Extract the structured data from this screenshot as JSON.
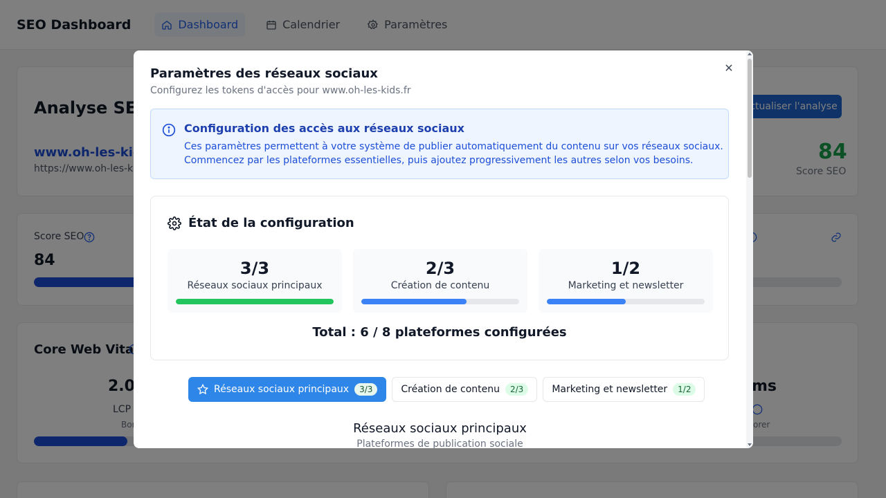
{
  "app": {
    "title": "SEO Dashboard",
    "nav": [
      {
        "label": "Dashboard",
        "icon": "home-icon",
        "active": true
      },
      {
        "label": "Calendrier",
        "icon": "calendar-icon",
        "active": false
      },
      {
        "label": "Paramètres",
        "icon": "gear-icon",
        "active": false
      }
    ]
  },
  "background": {
    "analysis_title": "Analyse SEO",
    "site_link": "www.oh-les-kids.",
    "site_url": "https://www.oh-les-kid",
    "refresh_button": "Actualiser l'analyse",
    "score_value": "84",
    "score_label": "Score SEO",
    "score_card_label": "Score SEO",
    "score_card_value": "84",
    "score_progress": 0.84,
    "core_web_vitals_title": "Core Web Vitals",
    "lcp_value": "2.0",
    "lcp_label": "LCP",
    "lcp_status": "Bon",
    "right_value": "ms",
    "right_status": "orer"
  },
  "modal": {
    "title": "Paramètres des réseaux sociaux",
    "subtitle": "Configurez les tokens d'accès pour www.oh-les-kids.fr",
    "close_icon": "close-icon",
    "info": {
      "icon": "info-icon",
      "title": "Configuration des accès aux réseaux sociaux",
      "line1": "Ces paramètres permettent à votre système de publier automatiquement du contenu sur vos réseaux sociaux.",
      "line2": "Commencez par les plateformes essentielles, puis ajoutez progressivement les autres selon vos besoins."
    },
    "status": {
      "icon": "gear-icon",
      "title": "État de la configuration",
      "items": [
        {
          "value": "3/3",
          "label": "Réseaux sociaux principaux",
          "progress": 1.0,
          "color": "#22c55e"
        },
        {
          "value": "2/3",
          "label": "Création de contenu",
          "progress": 0.667,
          "color": "#3b82f6"
        },
        {
          "value": "1/2",
          "label": "Marketing et newsletter",
          "progress": 0.5,
          "color": "#3b82f6"
        }
      ],
      "total": "Total : 6 / 8 plateformes configurées"
    },
    "tabs": [
      {
        "label": "Réseaux sociaux principaux",
        "badge": "3/3",
        "icon": "star-icon",
        "active": true
      },
      {
        "label": "Création de contenu",
        "badge": "2/3",
        "active": false
      },
      {
        "label": "Marketing et newsletter",
        "badge": "1/2",
        "active": false
      }
    ],
    "section": {
      "title": "Réseaux sociaux principaux",
      "subtitle": "Plateformes de publication sociale"
    }
  },
  "colors": {
    "accent": "#2e86e8",
    "success": "#22c55e",
    "info_bg": "#eef5ff",
    "info_text": "#1d4ed8"
  }
}
